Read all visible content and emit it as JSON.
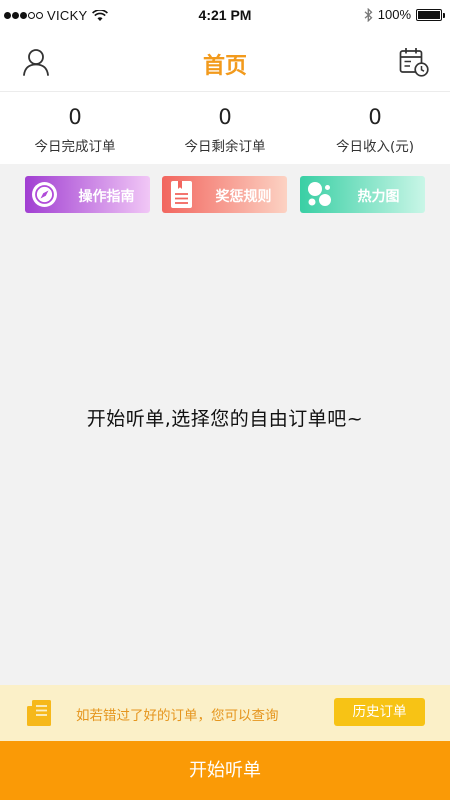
{
  "status_bar": {
    "carrier": "VICKY",
    "time": "4:21 PM",
    "battery": "100%",
    "signal_bars_filled": 3,
    "signal_bars_total": 5
  },
  "header": {
    "title": "首页",
    "left_icon": "user-icon",
    "right_icon": "calendar-clock-icon"
  },
  "stats": [
    {
      "value": "0",
      "label": "今日完成订单"
    },
    {
      "value": "0",
      "label": "今日剩余订单"
    },
    {
      "value": "0",
      "label": "今日收入(元)"
    }
  ],
  "quick_actions": [
    {
      "label": "操作指南",
      "icon": "compass-icon",
      "color_start": "#a13fd2",
      "color_end": "#f1c7f6"
    },
    {
      "label": "奖惩规则",
      "icon": "rulebook-icon",
      "color_start": "#f2665f",
      "color_end": "#fcd2c3"
    },
    {
      "label": "热力图",
      "icon": "heatmap-bubbles-icon",
      "color_start": "#39cfa4",
      "color_end": "#c9f6e7"
    }
  ],
  "main": {
    "empty_message": "开始听单,选择您的自由订单吧~"
  },
  "notice": {
    "text": "如若错过了好的订单，您可以查询",
    "history_button": "历史订单",
    "icon": "document-icon"
  },
  "start_button": {
    "label": "开始听单"
  },
  "colors": {
    "accent": "#f29a1c",
    "start_button": "#fa9a06",
    "history_button": "#f7c315",
    "notice_bg": "#fbf0c8"
  }
}
